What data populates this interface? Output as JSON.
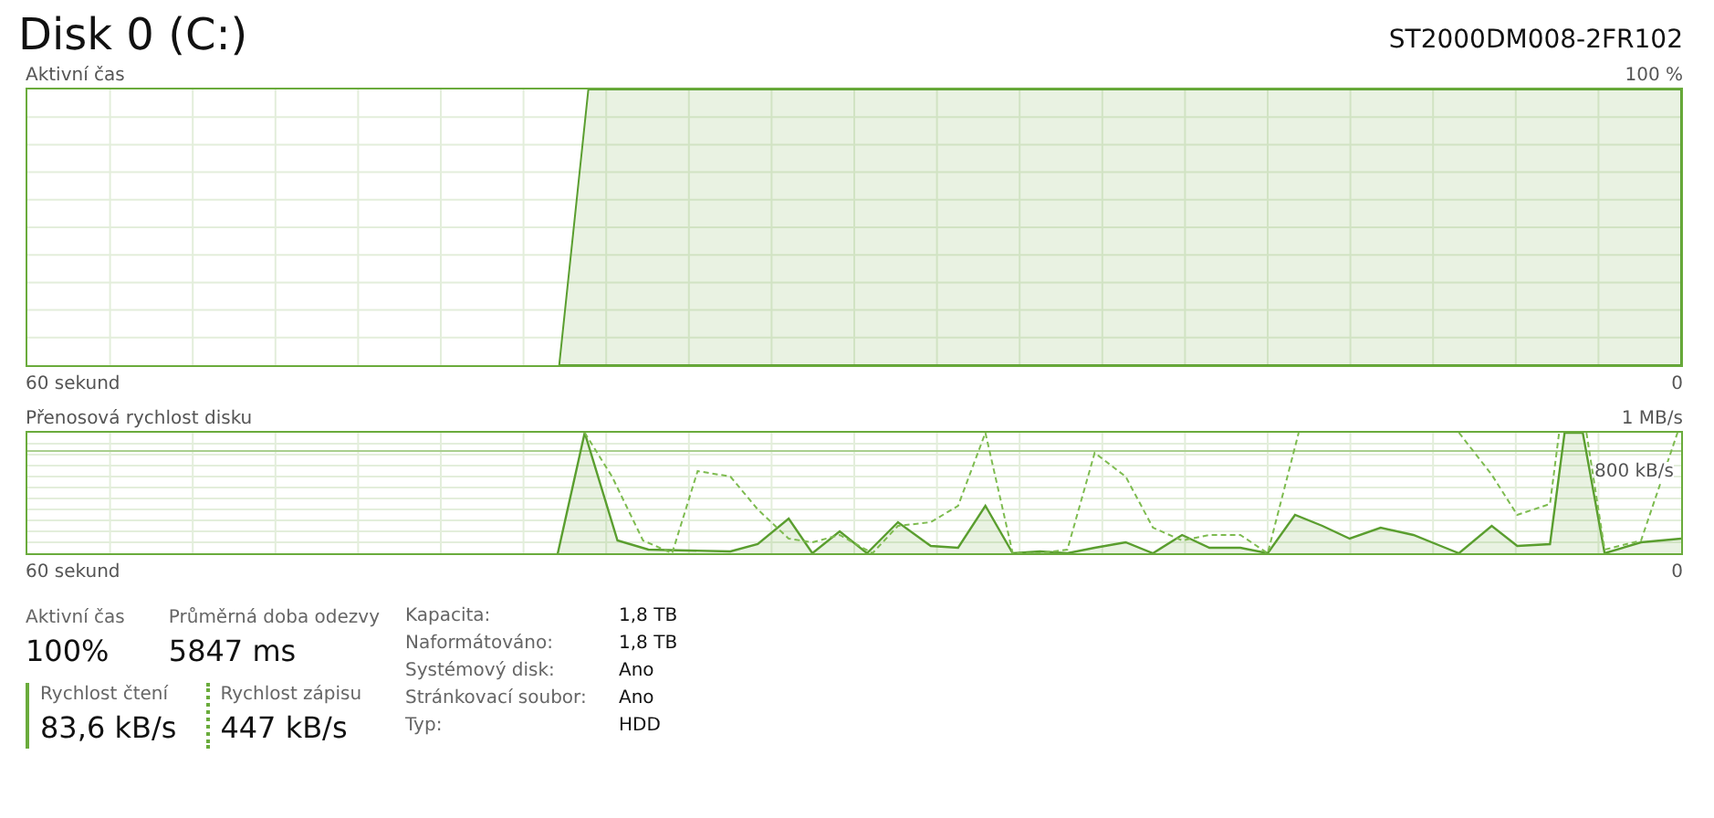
{
  "title": "Disk 0 (C:)",
  "model": "ST2000DM008-2FR102",
  "active_time_chart": {
    "label": "Aktivní čas",
    "max": "100 %",
    "time_span": "60 sekund",
    "min": "0"
  },
  "transfer_chart": {
    "label": "Přenosová rychlost disku",
    "max": "1 MB/s",
    "marker": "800 kB/s",
    "time_span": "60 sekund",
    "min": "0"
  },
  "stats": [
    {
      "label": "Aktivní čas",
      "value": "100%"
    },
    {
      "label": "Průměrná doba odezvy",
      "value": "5847 ms"
    }
  ],
  "speeds": [
    {
      "label": "Rychlost čtení",
      "value": "83,6 kB/s",
      "kind": "read"
    },
    {
      "label": "Rychlost zápisu",
      "value": "447 kB/s",
      "kind": "write"
    }
  ],
  "properties": [
    {
      "label": "Kapacita:",
      "value": "1,8 TB"
    },
    {
      "label": "Naformátováno:",
      "value": "1,8 TB"
    },
    {
      "label": "Systémový disk:",
      "value": "Ano"
    },
    {
      "label": "Stránkovací soubor:",
      "value": "Ano"
    },
    {
      "label": "Typ:",
      "value": "HDD"
    }
  ]
}
